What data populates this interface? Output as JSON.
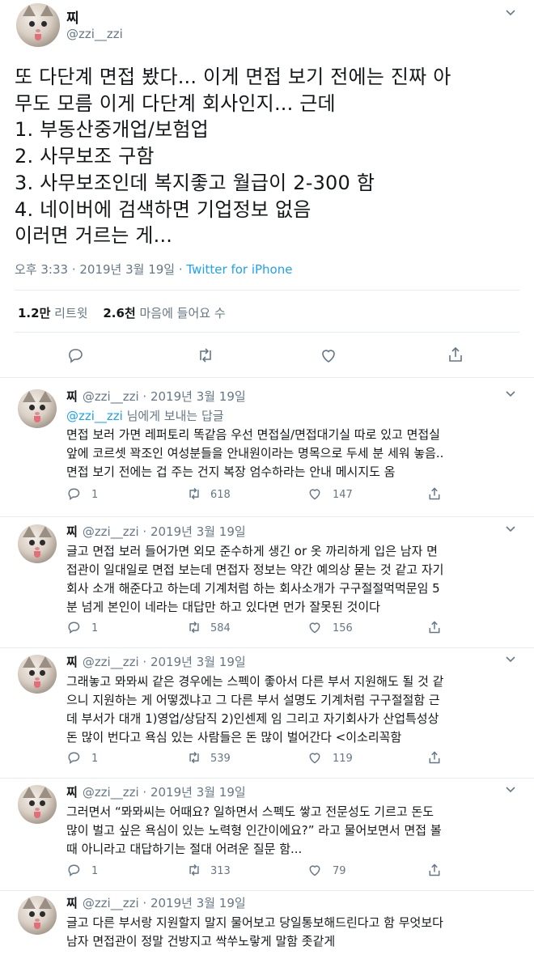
{
  "main": {
    "name": "찌",
    "handle": "@zzi__zzi",
    "text_lines": [
      "또 다단계 면접 봤다... 이게 면접 보기 전에는 진짜 아",
      "무도 모름 이게 다단계 회사인지... 근데",
      "1. 부동산중개업/보험업",
      "2. 사무보조 구함",
      "3. 사무보조인데 복지좋고 월급이 2-300 함",
      "4. 네이버에 검색하면 기업정보 없음",
      "이러면 거르는 게..."
    ],
    "time": "오후 3:33 · 2019년 3월 19일 · ",
    "via": "Twitter for iPhone",
    "retweets_count": "1.2만",
    "retweets_label": "리트윗",
    "likes_count": "2.6천",
    "likes_label": "마음에 들어요 수"
  },
  "replies": [
    {
      "name": "찌",
      "handle_date": "@zzi__zzi · 2019년 3월 19일",
      "reply_to_handle": "@zzi__zzi",
      "reply_to_suffix": " 님에게 보내는 답글",
      "lines": [
        "면접 보러 가면 레퍼토리 똑같음 우선 면접실/면접대기실 따로 있고 면접실",
        "앞에 코르셋 꽉조인 여성분들을 안내원이라는 명목으로 두세 분 세워 놓음..",
        "면접 보기 전에는 겁 주는 건지 복장 엄수하라는 안내 메시지도 옴"
      ],
      "replies": "1",
      "retweets": "618",
      "likes": "147"
    },
    {
      "name": "찌",
      "handle_date": "@zzi__zzi · 2019년 3월 19일",
      "lines": [
        "글고 면접 보러 들어가면 외모 준수하게 생긴 or 옷 까리하게 입은 남자 면",
        "접관이 일대일로 면접 보는데 면접자 정보는 약간 예의상 묻는 것 같고 자기",
        "회사 소개 해준다고 하는데 기계처럼 하는 회사소개가 구구절절먹먹문임 5",
        "분 넘게 본인이 네라는 대답만 하고 있다면 먼가 잘못된 것이다"
      ],
      "replies": "1",
      "retweets": "584",
      "likes": "156"
    },
    {
      "name": "찌",
      "handle_date": "@zzi__zzi · 2019년 3월 19일",
      "lines": [
        "그래놓고 뫄뫄씨 같은 경우에는 스펙이 좋아서 다른 부서 지원해도 될 것 같",
        "으니 지원하는 게 어떻겠냐고 그 다른 부서 설명도 기계처럼 구구절절함 근",
        "데 부서가 대개 1)영업/상담직 2)인센제 임 그리고 자기회사가 산업특성상",
        "돈 많이 번다고 욕심 있는 사람들은 돈 많이 벌어간다 <이소리꼭함"
      ],
      "replies": "1",
      "retweets": "539",
      "likes": "119"
    },
    {
      "name": "찌",
      "handle_date": "@zzi__zzi · 2019년 3월 19일",
      "lines": [
        "그러면서 “뫄뫄씨는 어때요? 일하면서 스펙도 쌓고 전문성도 기르고 돈도",
        "많이 벌고 싶은 욕심이 있는 노력형 인간이에요?” 라고 물어보면서 면접 볼",
        "때 아니라고 대답하기는 절대 어려운 질문 함..."
      ],
      "replies": "1",
      "retweets": "313",
      "likes": "79"
    },
    {
      "name": "찌",
      "handle_date": "@zzi__zzi · 2019년 3월 19일",
      "lines": [
        "글고 다른 부서랑 지원할지 말지 물어보고 당일통보해드린다고 함 무엇보다",
        "남자 면접관이 정말 건방지고 싹쑤노랗게 말함 좃같게"
      ]
    }
  ]
}
